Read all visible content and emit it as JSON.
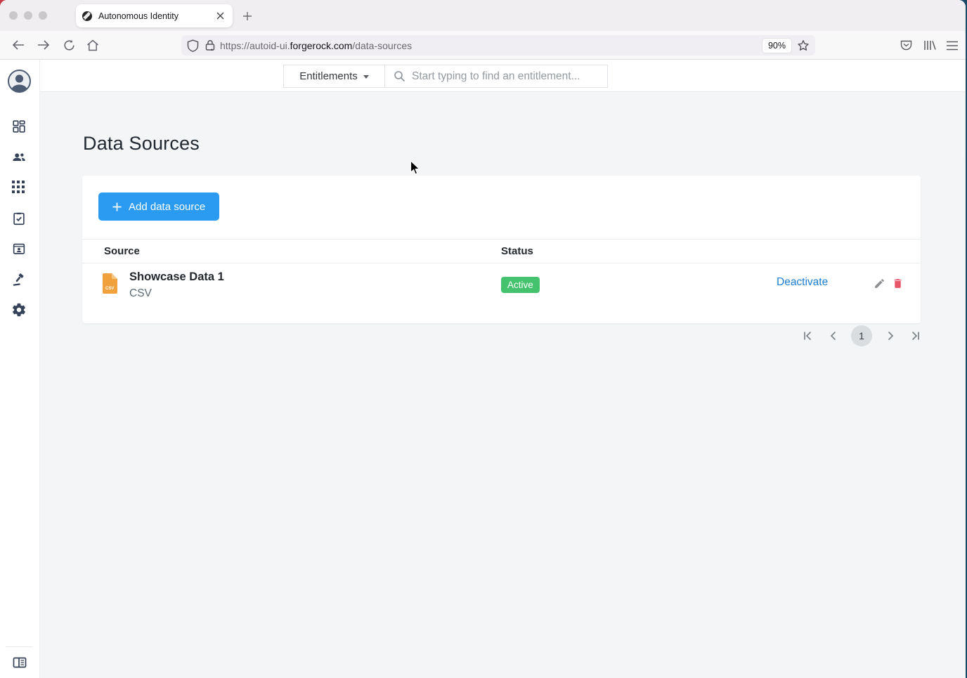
{
  "browser": {
    "tab": {
      "title": "Autonomous Identity"
    },
    "url": {
      "scheme_sub": "https://autoid-ui.",
      "domain": "forgerock.com",
      "path": "/data-sources"
    },
    "zoom_level": "90%"
  },
  "topbar": {
    "context_dropdown": "Entitlements",
    "search_placeholder": "Start typing to find an entitlement..."
  },
  "sidebar": {
    "icons": [
      "dashboard-icon",
      "users-icon",
      "apps-grid-icon",
      "tasks-check-icon",
      "id-badge-icon",
      "gavel-icon",
      "settings-gear-icon"
    ],
    "bottom_icon": "panel-toggle-icon"
  },
  "page": {
    "title": "Data Sources",
    "add_button": "Add data source",
    "table": {
      "columns": [
        "Source",
        "Status"
      ],
      "rows": [
        {
          "name": "Showcase Data 1",
          "type": "CSV",
          "status": "Active",
          "action": "Deactivate",
          "file_label": "CSV"
        }
      ]
    },
    "pagination": {
      "current_page": "1"
    }
  },
  "colors": {
    "accent_blue": "#2b9bf2",
    "status_active_green": "#45c26d",
    "delete_red": "#e8566b",
    "link_blue": "#1c7ed2",
    "sidebar_icon_navy": "#35425a",
    "csv_icon_orange": "#f0a13c"
  }
}
